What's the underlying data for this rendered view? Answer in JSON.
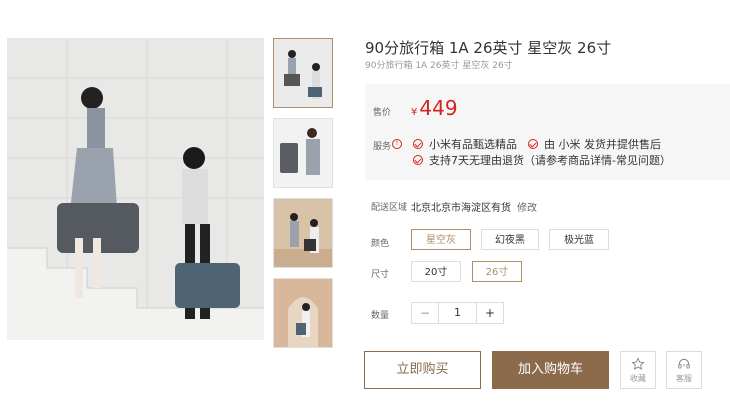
{
  "product": {
    "title": "90分旅行箱 1A 26英寸 星空灰 26寸",
    "subtitle": "90分旅行箱 1A 26英寸 星空灰 26寸"
  },
  "price": {
    "label": "售价",
    "currency": "¥",
    "value": "449"
  },
  "service": {
    "label": "服务",
    "info_icon": "!",
    "items": [
      "小米有品甄选精品",
      "由 小米 发货并提供售后",
      "支持7天无理由退货（请参考商品详情-常见问题）"
    ]
  },
  "region": {
    "label": "配送区域",
    "value": "北京北京市海淀区有货",
    "edit": "修改"
  },
  "color": {
    "label": "颜色",
    "options": [
      "星空灰",
      "幻夜黑",
      "极光蓝"
    ],
    "selected": "星空灰"
  },
  "size": {
    "label": "尺寸",
    "options": [
      "20寸",
      "26寸"
    ],
    "selected": "26寸"
  },
  "quantity": {
    "label": "数量",
    "value": "1",
    "minus": "−",
    "plus": "+"
  },
  "actions": {
    "buy_now": "立即购买",
    "add_to_cart": "加入购物车",
    "favorite": "收藏",
    "service": "客服"
  },
  "theme": {
    "accent": "#8c6a4c",
    "price_red": "#d3241d"
  },
  "icons": {
    "favorite": "star-icon",
    "service": "headset-icon",
    "check": "check-circle-icon"
  }
}
